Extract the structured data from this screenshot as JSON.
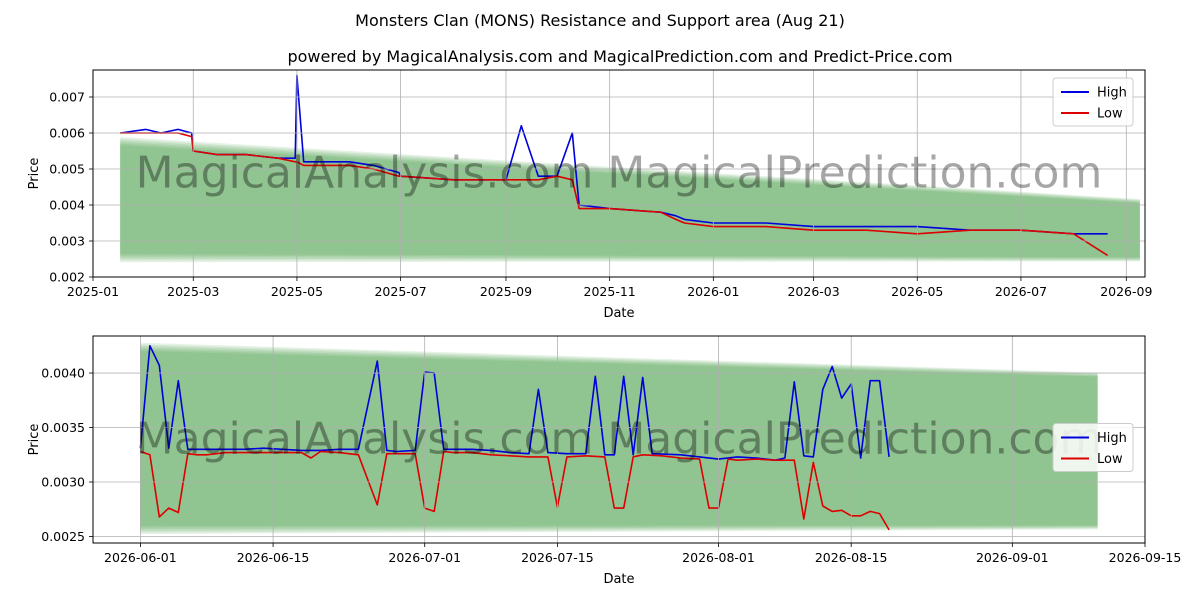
{
  "title": "Monsters Clan (MONS) Resistance and Support area (Aug 21)",
  "subtitle": "powered by MagicalAnalysis.com and MagicalPrediction.com and Predict-Price.com",
  "watermark": "MagicalAnalysis.com   MagicalPrediction.com",
  "colors": {
    "high": "#0000dd",
    "low": "#dd0000",
    "band": "#3a9e3a",
    "grid": "#b0b0b0"
  },
  "chart_data": [
    {
      "type": "line",
      "xlabel": "Date",
      "ylabel": "Price",
      "x_ticks": [
        "2025-01",
        "2025-03",
        "2025-05",
        "2025-07",
        "2025-09",
        "2025-11",
        "2026-01",
        "2026-03",
        "2026-05",
        "2026-07",
        "2026-09"
      ],
      "y_ticks": [
        "0.002",
        "0.003",
        "0.004",
        "0.005",
        "0.006",
        "0.007"
      ],
      "ylim": [
        0.002,
        0.00775
      ],
      "xlim": [
        "2025-01-01",
        "2026-09-12"
      ],
      "grid": true,
      "legend": "top-right",
      "legend_entries": [
        "High",
        "Low"
      ],
      "band_x": [
        "2025-01-17",
        "2026-09-09"
      ],
      "band_upper": [
        0.0055,
        0.004
      ],
      "band_lower": [
        0.0028,
        0.0026
      ],
      "series": [
        {
          "name": "High",
          "x": [
            "2025-01-17",
            "2025-02-01",
            "2025-02-10",
            "2025-02-20",
            "2025-02-28",
            "2025-03-01",
            "2025-03-15",
            "2025-04-01",
            "2025-04-20",
            "2025-04-30",
            "2025-05-01",
            "2025-05-05",
            "2025-06-01",
            "2025-06-15",
            "2025-06-30",
            "2025-07-01",
            "2025-08-01",
            "2025-08-20",
            "2025-09-01",
            "2025-09-10",
            "2025-09-20",
            "2025-10-01",
            "2025-10-10",
            "2025-10-14",
            "2025-11-01",
            "2025-12-01",
            "2025-12-10",
            "2025-12-15",
            "2026-01-01",
            "2026-02-01",
            "2026-03-01",
            "2026-04-01",
            "2026-05-01",
            "2026-06-01",
            "2026-07-01",
            "2026-08-01",
            "2026-08-21"
          ],
          "y": [
            0.006,
            0.0061,
            0.006,
            0.0061,
            0.006,
            0.0055,
            0.0054,
            0.0054,
            0.0053,
            0.0053,
            0.0076,
            0.0052,
            0.0052,
            0.0051,
            0.0049,
            0.0048,
            0.0047,
            0.0047,
            0.0047,
            0.0062,
            0.0048,
            0.0048,
            0.006,
            0.004,
            0.0039,
            0.0038,
            0.0037,
            0.0036,
            0.0035,
            0.0035,
            0.0034,
            0.0034,
            0.0034,
            0.0033,
            0.0033,
            0.0032,
            0.0032
          ]
        },
        {
          "name": "Low",
          "x": [
            "2025-01-17",
            "2025-02-01",
            "2025-02-10",
            "2025-02-20",
            "2025-02-28",
            "2025-03-01",
            "2025-03-15",
            "2025-04-01",
            "2025-04-20",
            "2025-04-30",
            "2025-05-01",
            "2025-05-05",
            "2025-06-01",
            "2025-06-15",
            "2025-06-30",
            "2025-07-01",
            "2025-08-01",
            "2025-08-20",
            "2025-09-01",
            "2025-09-10",
            "2025-09-20",
            "2025-10-01",
            "2025-10-10",
            "2025-10-14",
            "2025-11-01",
            "2025-12-01",
            "2025-12-10",
            "2025-12-15",
            "2026-01-01",
            "2026-02-01",
            "2026-03-01",
            "2026-04-01",
            "2026-05-01",
            "2026-06-01",
            "2026-07-01",
            "2026-08-01",
            "2026-08-21"
          ],
          "y": [
            0.006,
            0.006,
            0.006,
            0.006,
            0.0059,
            0.0055,
            0.0054,
            0.0054,
            0.0053,
            0.0052,
            0.0052,
            0.0051,
            0.0051,
            0.005,
            0.0048,
            0.0048,
            0.0047,
            0.0047,
            0.0047,
            0.0047,
            0.0047,
            0.0048,
            0.0047,
            0.0039,
            0.0039,
            0.0038,
            0.0036,
            0.0035,
            0.0034,
            0.0034,
            0.0033,
            0.0033,
            0.0032,
            0.0033,
            0.0033,
            0.0032,
            0.0026
          ]
        }
      ]
    },
    {
      "type": "line",
      "xlabel": "Date",
      "ylabel": "Price",
      "x_ticks": [
        "2026-06-01",
        "2026-06-15",
        "2026-07-01",
        "2026-07-15",
        "2026-08-01",
        "2026-08-15",
        "2026-09-01",
        "2026-09-15"
      ],
      "y_ticks": [
        "0.0025",
        "0.0030",
        "0.0035",
        "0.0040"
      ],
      "ylim": [
        0.00244,
        0.00434
      ],
      "xlim": [
        "2026-05-27",
        "2026-09-15"
      ],
      "grid": true,
      "legend": "center-right",
      "legend_entries": [
        "High",
        "Low"
      ],
      "band_x": [
        "2026-06-01",
        "2026-09-10"
      ],
      "band_upper": [
        0.00415,
        0.00395
      ],
      "band_lower": [
        0.00265,
        0.00262
      ],
      "series": [
        {
          "name": "High",
          "x": [
            "2026-06-01",
            "2026-06-02",
            "2026-06-03",
            "2026-06-04",
            "2026-06-05",
            "2026-06-06",
            "2026-06-07",
            "2026-06-08",
            "2026-06-10",
            "2026-06-12",
            "2026-06-14",
            "2026-06-16",
            "2026-06-18",
            "2026-06-20",
            "2026-06-22",
            "2026-06-24",
            "2026-06-26",
            "2026-06-27",
            "2026-06-28",
            "2026-06-30",
            "2026-07-01",
            "2026-07-02",
            "2026-07-03",
            "2026-07-04",
            "2026-07-06",
            "2026-07-08",
            "2026-07-10",
            "2026-07-12",
            "2026-07-13",
            "2026-07-14",
            "2026-07-16",
            "2026-07-18",
            "2026-07-19",
            "2026-07-20",
            "2026-07-21",
            "2026-07-22",
            "2026-07-23",
            "2026-07-24",
            "2026-07-25",
            "2026-07-28",
            "2026-07-30",
            "2026-08-01",
            "2026-08-03",
            "2026-08-05",
            "2026-08-07",
            "2026-08-08",
            "2026-08-09",
            "2026-08-10",
            "2026-08-11",
            "2026-08-12",
            "2026-08-13",
            "2026-08-14",
            "2026-08-15",
            "2026-08-16",
            "2026-08-17",
            "2026-08-18",
            "2026-08-19"
          ],
          "y": [
            0.00331,
            0.00425,
            0.00407,
            0.00331,
            0.00393,
            0.0033,
            0.0033,
            0.0033,
            0.0033,
            0.0033,
            0.00331,
            0.0033,
            0.00329,
            0.00329,
            0.0033,
            0.0033,
            0.00411,
            0.00329,
            0.00328,
            0.00329,
            0.00401,
            0.004,
            0.0033,
            0.0033,
            0.0033,
            0.00329,
            0.00327,
            0.00326,
            0.00385,
            0.00327,
            0.00326,
            0.00326,
            0.00397,
            0.00325,
            0.00325,
            0.00397,
            0.00325,
            0.00396,
            0.00326,
            0.00325,
            0.00323,
            0.00321,
            0.00323,
            0.00322,
            0.0032,
            0.00322,
            0.00392,
            0.00324,
            0.00323,
            0.00385,
            0.00406,
            0.00377,
            0.0039,
            0.00322,
            0.00393,
            0.00393,
            0.00323
          ]
        },
        {
          "name": "Low",
          "x": [
            "2026-06-01",
            "2026-06-02",
            "2026-06-03",
            "2026-06-04",
            "2026-06-05",
            "2026-06-06",
            "2026-06-07",
            "2026-06-08",
            "2026-06-10",
            "2026-06-12",
            "2026-06-14",
            "2026-06-16",
            "2026-06-18",
            "2026-06-19",
            "2026-06-20",
            "2026-06-22",
            "2026-06-24",
            "2026-06-26",
            "2026-06-27",
            "2026-06-28",
            "2026-06-30",
            "2026-07-01",
            "2026-07-02",
            "2026-07-03",
            "2026-07-04",
            "2026-07-06",
            "2026-07-08",
            "2026-07-10",
            "2026-07-12",
            "2026-07-14",
            "2026-07-15",
            "2026-07-16",
            "2026-07-18",
            "2026-07-20",
            "2026-07-21",
            "2026-07-22",
            "2026-07-23",
            "2026-07-24",
            "2026-07-26",
            "2026-07-28",
            "2026-07-30",
            "2026-07-31",
            "2026-08-01",
            "2026-08-02",
            "2026-08-03",
            "2026-08-05",
            "2026-08-07",
            "2026-08-09",
            "2026-08-10",
            "2026-08-11",
            "2026-08-12",
            "2026-08-13",
            "2026-08-14",
            "2026-08-15",
            "2026-08-16",
            "2026-08-17",
            "2026-08-18",
            "2026-08-19"
          ],
          "y": [
            0.00328,
            0.00325,
            0.00268,
            0.00276,
            0.00272,
            0.00326,
            0.00325,
            0.00325,
            0.00327,
            0.00327,
            0.00327,
            0.00327,
            0.00327,
            0.00322,
            0.00328,
            0.00327,
            0.00325,
            0.00279,
            0.00326,
            0.00326,
            0.00326,
            0.00276,
            0.00273,
            0.00328,
            0.00327,
            0.00327,
            0.00325,
            0.00324,
            0.00323,
            0.00323,
            0.00277,
            0.00323,
            0.00324,
            0.00323,
            0.00276,
            0.00276,
            0.00323,
            0.00325,
            0.00324,
            0.00322,
            0.00321,
            0.00276,
            0.00276,
            0.00321,
            0.0032,
            0.00321,
            0.0032,
            0.0032,
            0.00266,
            0.00318,
            0.00278,
            0.00273,
            0.00274,
            0.00269,
            0.00269,
            0.00273,
            0.00271,
            0.00256
          ]
        }
      ]
    }
  ]
}
